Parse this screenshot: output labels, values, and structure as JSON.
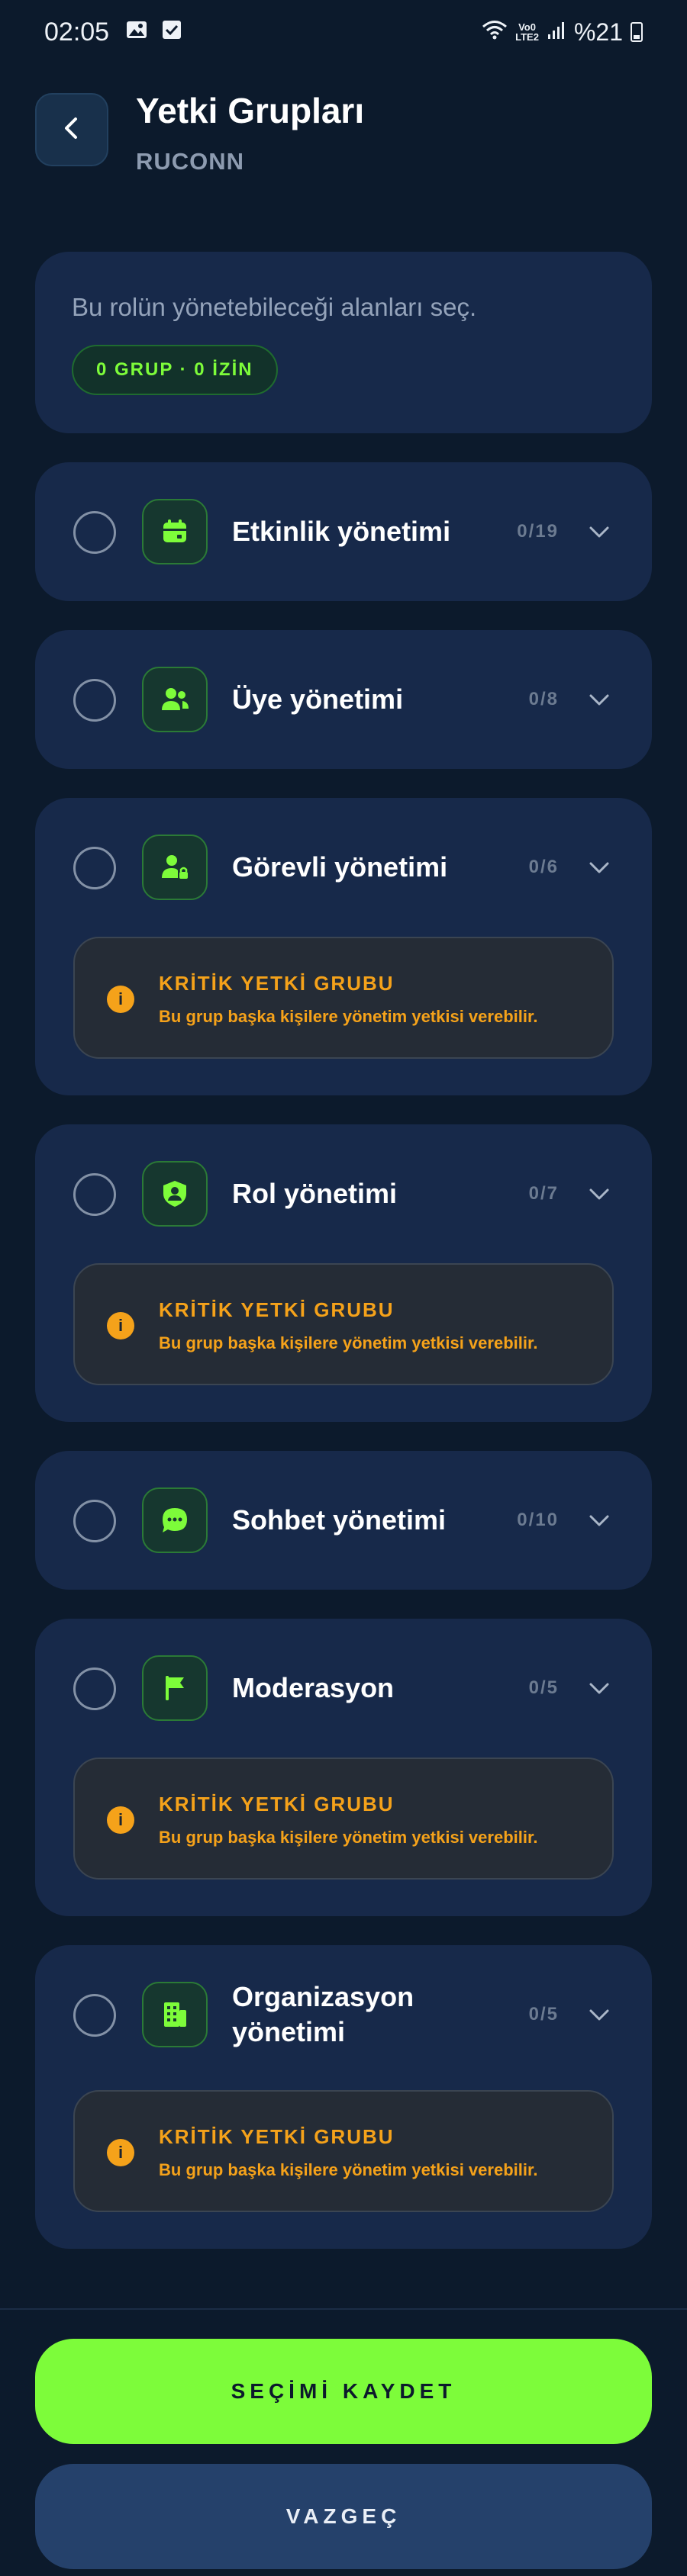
{
  "status_bar": {
    "time": "02:05",
    "network_badge": "LTE2",
    "volte": "Vo0",
    "battery_text": "%21",
    "left_icons": [
      "image-icon",
      "check-square-icon"
    ],
    "right_icons": [
      "wifi-icon",
      "signal-icon",
      "battery-icon"
    ]
  },
  "header": {
    "title": "Yetki Grupları",
    "subtitle": "RUCONN",
    "back_icon": "chevron-left-icon"
  },
  "intro": {
    "text": "Bu rolün yönetebileceği alanları seç.",
    "summary": "0 GRUP · 0 İZİN"
  },
  "warning": {
    "title": "KRİTİK YETKİ GRUBU",
    "description": "Bu grup başka kişilere yönetim yetkisi verebilir."
  },
  "groups": [
    {
      "label": "Etkinlik yönetimi",
      "count": "0/19",
      "icon": "calendar-icon",
      "critical": false
    },
    {
      "label": "Üye yönetimi",
      "count": "0/8",
      "icon": "users-icon",
      "critical": false
    },
    {
      "label": "Görevli yönetimi",
      "count": "0/6",
      "icon": "user-lock-icon",
      "critical": true
    },
    {
      "label": "Rol yönetimi",
      "count": "0/7",
      "icon": "shield-user-icon",
      "critical": true
    },
    {
      "label": "Sohbet yönetimi",
      "count": "0/10",
      "icon": "chat-icon",
      "critical": false
    },
    {
      "label": "Moderasyon",
      "count": "0/5",
      "icon": "flag-icon",
      "critical": true
    },
    {
      "label": "Organizasyon yönetimi",
      "count": "0/5",
      "icon": "building-icon",
      "critical": true
    }
  ],
  "actions": {
    "save": "SEÇİMİ KAYDET",
    "cancel": "VAZGEÇ"
  },
  "colors": {
    "background": "#0c1a2c",
    "card": "#17294a",
    "accent": "#7dfc3a",
    "warning": "#f5a21a",
    "secondary_button": "#25416b"
  }
}
